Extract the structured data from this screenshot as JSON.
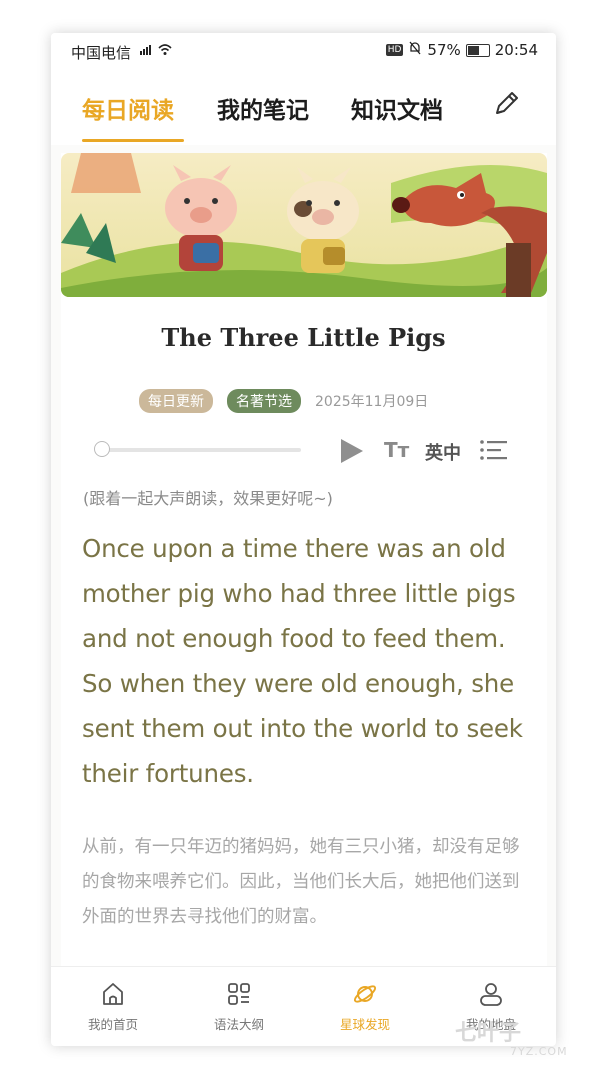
{
  "status_bar": {
    "carrier": "中国电信",
    "network": "⁴ᴳ",
    "hd": "HD",
    "battery": "57%",
    "time": "20:54"
  },
  "tabs": [
    {
      "label": "每日阅读",
      "active": true
    },
    {
      "label": "我的笔记",
      "active": false
    },
    {
      "label": "知识文档",
      "active": false
    }
  ],
  "article": {
    "title": "The Three Little Pigs",
    "tags": [
      "每日更新",
      "名著节选"
    ],
    "date": "2025年11月09日",
    "player": {
      "progress": 0,
      "font_label": "Tт",
      "lang_label": "英中"
    },
    "hint": "(跟着一起大声朗读，效果更好呢~)",
    "english": "Once upon a time there was an old mother pig who had three little pigs and not enough food to feed them. So when they were old enough, she sent them out into the world to seek their fortunes.",
    "chinese": "从前，有一只年迈的猪妈妈，她有三只小猪，却没有足够的食物来喂养它们。因此，当他们长大后，她把他们送到外面的世界去寻找他们的财富。"
  },
  "bottom_nav": [
    {
      "label": "我的首页",
      "icon": "home-icon",
      "active": false
    },
    {
      "label": "语法大纲",
      "icon": "grid-list-icon",
      "active": false
    },
    {
      "label": "星球发现",
      "icon": "planet-icon",
      "active": true
    },
    {
      "label": "我的地盘",
      "icon": "user-icon",
      "active": false
    }
  ],
  "colors": {
    "accent": "#e9a725",
    "text_en": "#7a7446",
    "badge_daily": "#cbb89a",
    "badge_classic": "#6e8b5d"
  },
  "watermark": {
    "text": "七叶子",
    "sub": "7YZ.COM"
  }
}
